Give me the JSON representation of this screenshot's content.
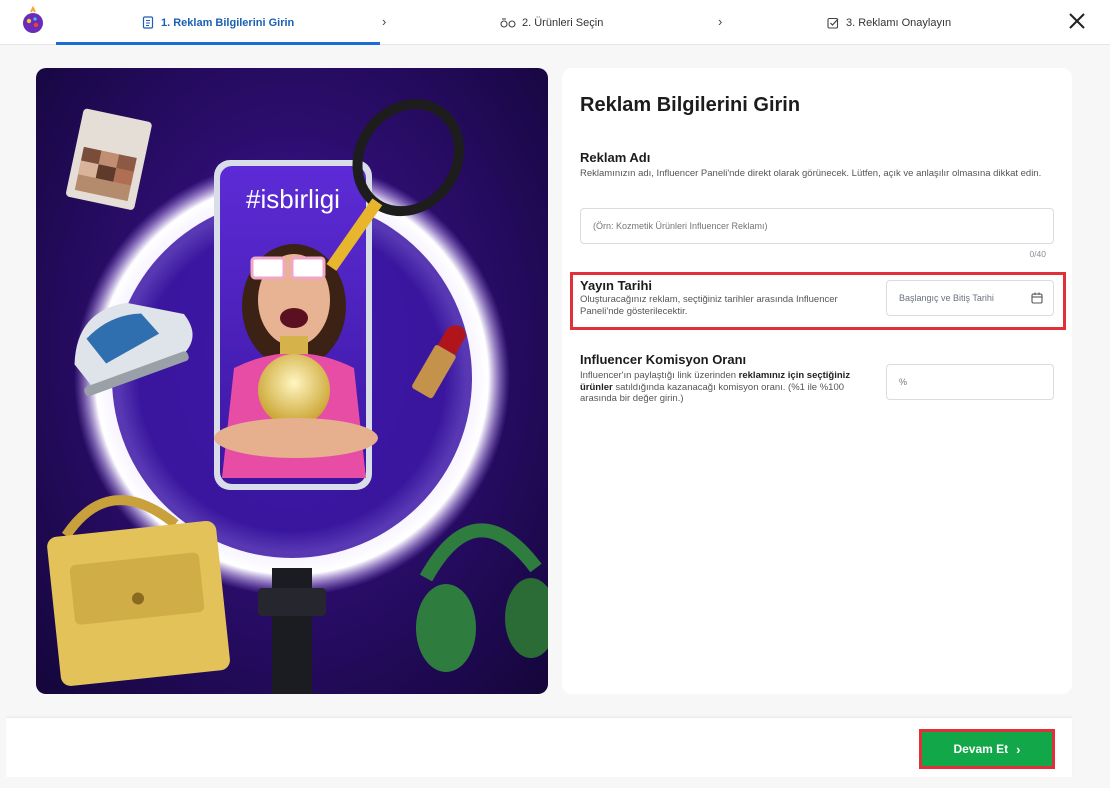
{
  "stepper": {
    "steps": [
      {
        "label": "1. Reklam Bilgilerini Girin",
        "icon": "document-icon",
        "active": true
      },
      {
        "label": "2. Ürünleri Seçin",
        "icon": "products-icon",
        "active": false
      },
      {
        "label": "3. Reklamı Onaylayın",
        "icon": "checkbox-icon",
        "active": false
      }
    ],
    "chevron": "›",
    "close_icon": "close-icon"
  },
  "hero": {
    "hashtag": "#isbirligi"
  },
  "form": {
    "title": "Reklam Bilgilerini Girin",
    "ad_name": {
      "title": "Reklam Adı",
      "description": "Reklamınızın adı, Influencer Paneli'nde direkt olarak görünecek. Lütfen, açık ve anlaşılır olmasına dikkat edin.",
      "placeholder": "(Örn: Kozmetik Ürünleri Influencer Reklamı)",
      "counter": "0/40"
    },
    "publish_date": {
      "title": "Yayın Tarihi",
      "description": "Oluşturacağınız reklam, seçtiğiniz tarihler arasında Influencer Paneli'nde gösterilecektir.",
      "placeholder": "Başlangıç ve Bitiş Tarihi",
      "icon": "calendar-icon"
    },
    "commission": {
      "title": "Influencer Komisyon Oranı",
      "desc_part1": "Influencer'ın paylaştığı link üzerinden ",
      "desc_bold": "reklamınız için seçtiğiniz ürünler",
      "desc_part2": " satıldığında kazanacağı komisyon oranı. (%1 ile %100 arasında bir değer girin.)",
      "placeholder": "%"
    }
  },
  "footer": {
    "continue_label": "Devam Et",
    "continue_arrow": "›"
  },
  "colors": {
    "accent_blue": "#1a6dd4",
    "cta_green": "#12a84a",
    "highlight_red": "#e0303a",
    "hero_purple": "#4b1fa8"
  }
}
